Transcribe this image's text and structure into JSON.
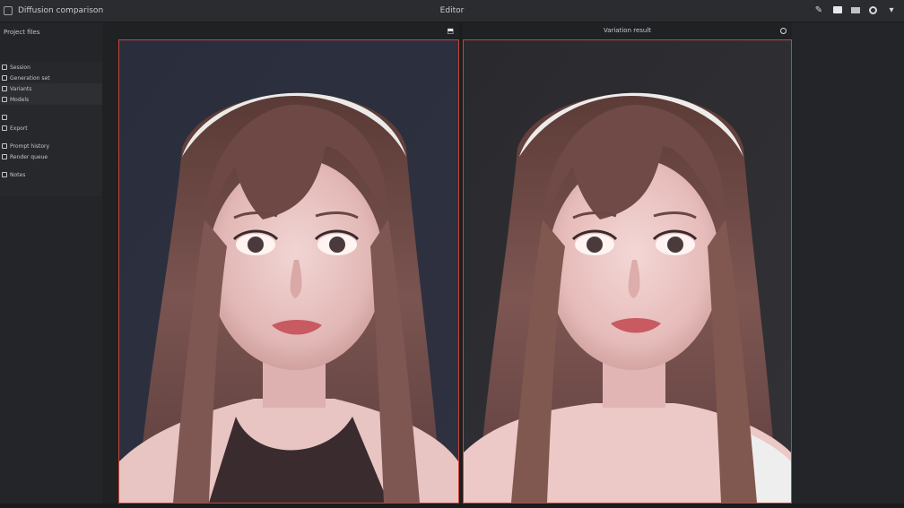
{
  "titlebar": {
    "title": "Diffusion comparison",
    "center_label": "Editor",
    "tools": [
      "pen-icon",
      "window-icon",
      "layout-icon",
      "settings-icon",
      "menu-icon"
    ]
  },
  "sidebar": {
    "heading": "Project files",
    "items": [
      {
        "label": "Session",
        "selected": false
      },
      {
        "label": "Generation set",
        "selected": false
      },
      {
        "label": "Variants",
        "selected": true
      },
      {
        "label": "Models",
        "selected": true
      },
      {
        "label": "",
        "selected": false
      },
      {
        "label": "Export",
        "selected": false
      },
      {
        "label": "",
        "selected": false
      },
      {
        "label": "Prompt history",
        "selected": false
      },
      {
        "label": "Render queue",
        "selected": false
      },
      {
        "label": "",
        "selected": false
      },
      {
        "label": "Notes",
        "selected": false
      }
    ]
  },
  "panels": {
    "left": {
      "header": "",
      "icon": "pin-icon"
    },
    "right": {
      "header": "Variation result",
      "icon": "circle-icon"
    }
  },
  "colors": {
    "frame_accent": "#c2473b",
    "background": "#232528",
    "titlebar": "#2a2c2f"
  }
}
